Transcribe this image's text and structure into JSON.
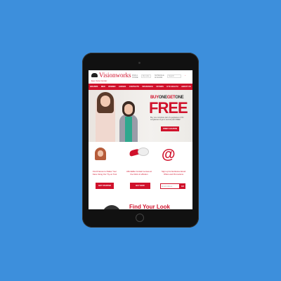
{
  "header": {
    "logo": "Visionworks",
    "tagline": "Eye Care Center",
    "find_store_label": "FIND A STORE",
    "zip_placeholder": "Zip code",
    "schedule_label": "SCHEDULE AN EXAM",
    "search_placeholder": "Search"
  },
  "nav": [
    "BRANDS",
    "MEN",
    "WOMEN",
    "LENSES",
    "CONTACTS",
    "INSURANCE",
    "OFFERS",
    "EYE HEALTH",
    "ABOUT US"
  ],
  "hero": {
    "headline_parts": [
      "BUY",
      "ONE",
      "GET",
      "ONE"
    ],
    "big": "FREE",
    "subtext": "Buy one complete pair of eyeglasses or Rx sunglasses & get a second pair FREE!",
    "cta": "PRINT COUPON"
  },
  "features": [
    {
      "text": "Find Frames to Flatter Your Face Using Our Try-on Tool",
      "button": "GET STARTED"
    },
    {
      "text": "Affordable Contact Lenses at the Click of a Button",
      "button": "BUY NOW"
    },
    {
      "text": "Sign up for Exclusive Email Offers and Promotions",
      "email_placeholder": "Email Address",
      "button": "GO"
    }
  ],
  "section_title": "Find Your Look"
}
